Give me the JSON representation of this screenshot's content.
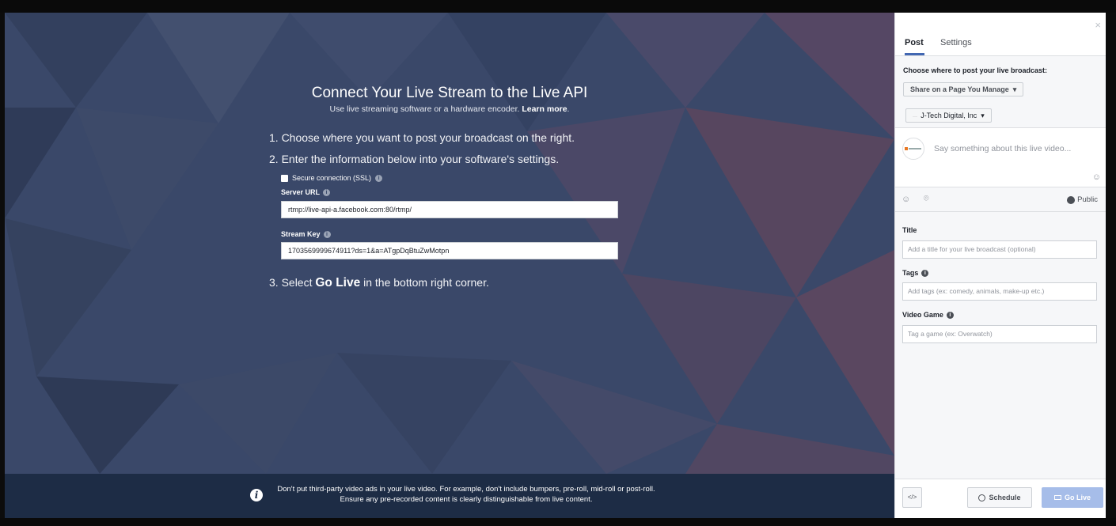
{
  "main": {
    "title": "Connect Your Live Stream to the Live API",
    "subtitle_text": "Use live streaming software or a hardware encoder.",
    "subtitle_link": "Learn more",
    "subtitle_end": ".",
    "step1": "1. Choose where you want to post your broadcast on the right.",
    "step2": "2. Enter the information below into your software's settings.",
    "ssl_label": "Secure connection (SSL)",
    "server_url_label": "Server URL",
    "server_url_value": "rtmp://live-api-a.facebook.com:80/rtmp/",
    "stream_key_label": "Stream Key",
    "stream_key_value": "1703569999674911?ds=1&a=ATgpDqBtuZwMotpn",
    "step3_prefix": "3. Select",
    "step3_bold": "Go Live",
    "step3_suffix": "in the bottom right corner.",
    "notice": "Don't put third-party video ads in your live video. For example, don't include bumpers, pre-roll, mid-roll or post-roll. Ensure any pre-recorded content is clearly distinguishable from live content."
  },
  "panel": {
    "close": "×",
    "tabs": [
      {
        "label": "Post"
      },
      {
        "label": "Settings"
      }
    ],
    "choose_label": "Choose where to post your live broadcast:",
    "share_dropdown": "Share on a Page You Manage",
    "page_dropdown": "J-Tech Digital, Inc",
    "composer_placeholder": "Say something about this live video...",
    "privacy": "Public",
    "title_label": "Title",
    "title_placeholder": "Add a title for your live broadcast (optional)",
    "tags_label": "Tags",
    "tags_placeholder": "Add tags (ex: comedy, animals, make-up etc.)",
    "game_label": "Video Game",
    "game_placeholder": "Tag a game (ex: Overwatch)",
    "embed_label": "</>",
    "schedule_label": "Schedule",
    "golive_label": "Go Live"
  },
  "colors": {
    "accent": "#4267b2",
    "golive_disabled": "#a6bde9",
    "stage_bg": "#3b4a6b",
    "notice_bg": "#1d2c45"
  }
}
